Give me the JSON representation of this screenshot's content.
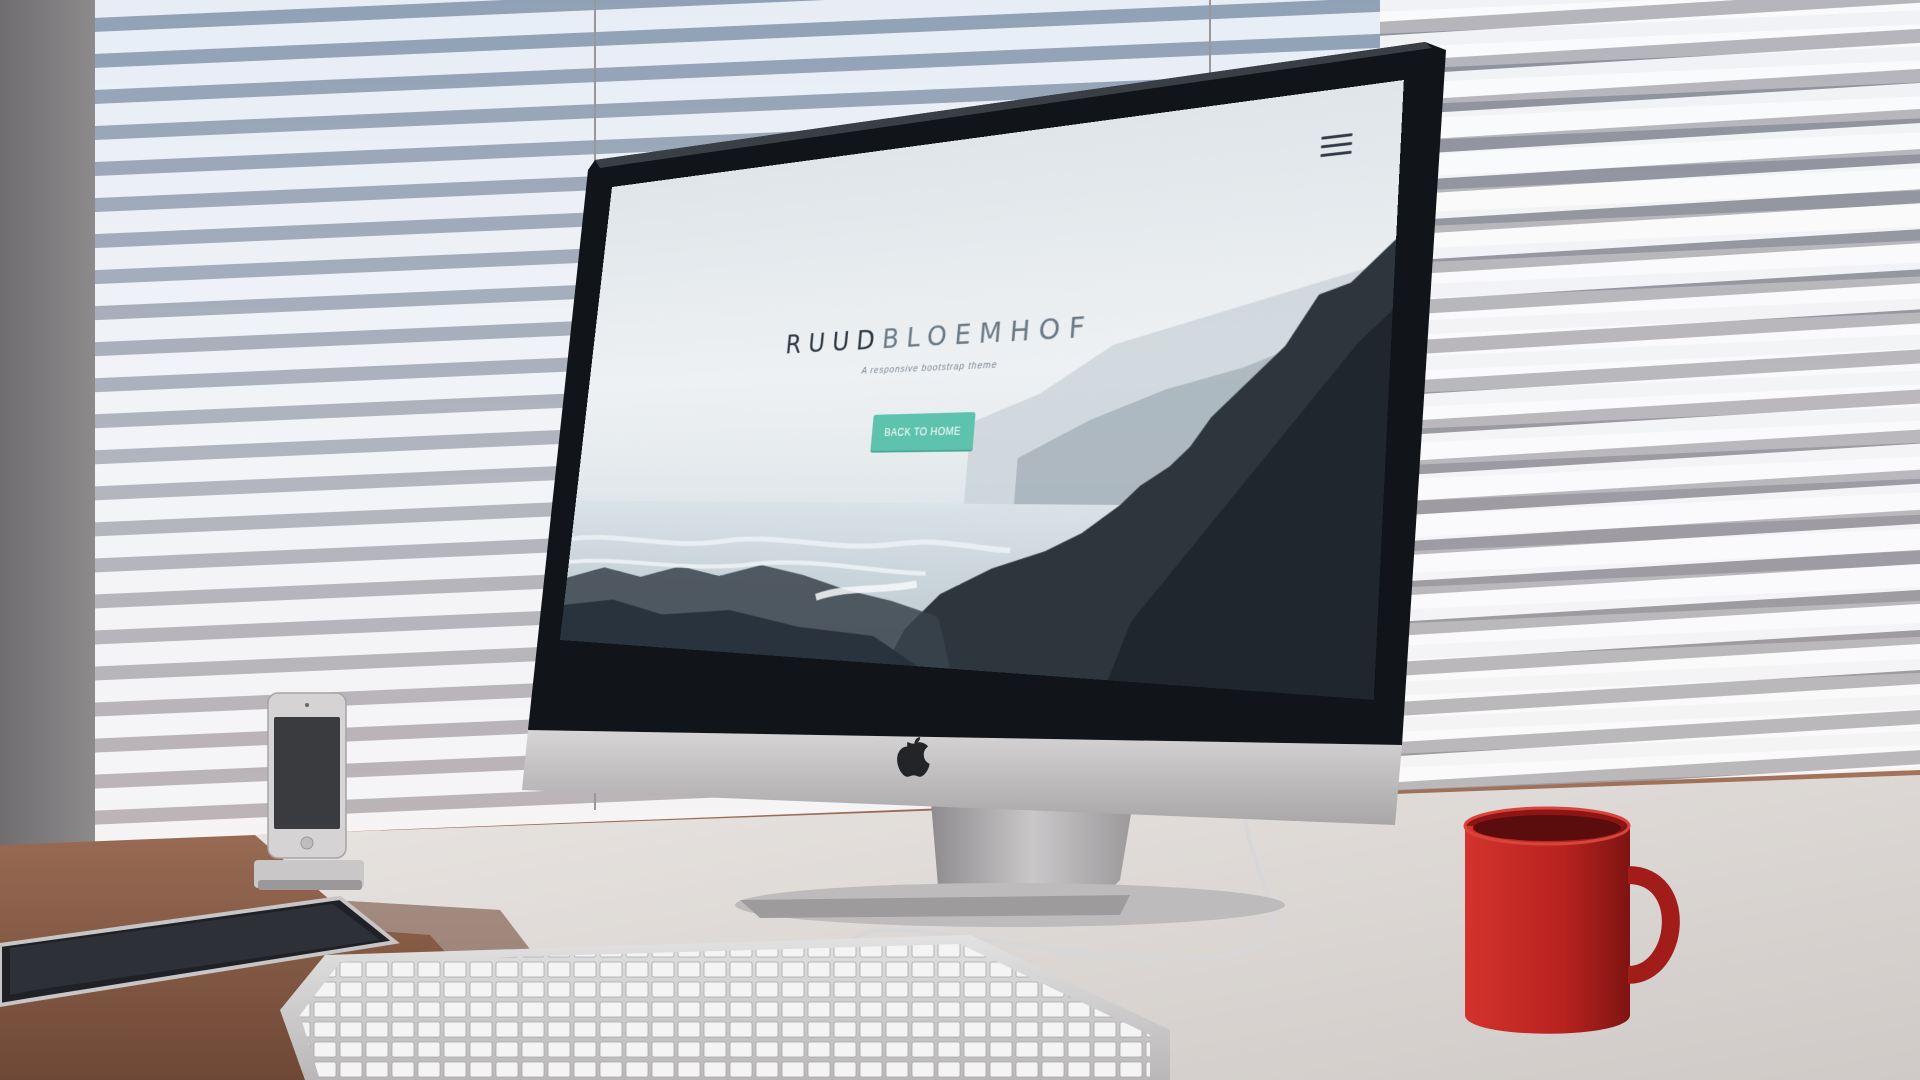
{
  "website": {
    "brand_part1": "RUUD",
    "brand_part2": "BLOEMHOF",
    "tagline": "A responsive bootstrap theme",
    "button_label": "BACK TO HOME",
    "menu_icon": "hamburger-menu-icon",
    "accent_color": "#5ec3ae"
  },
  "devices": {
    "monitor_logo_icon": "apple-logo-icon",
    "mug_color": "#b8221f"
  }
}
